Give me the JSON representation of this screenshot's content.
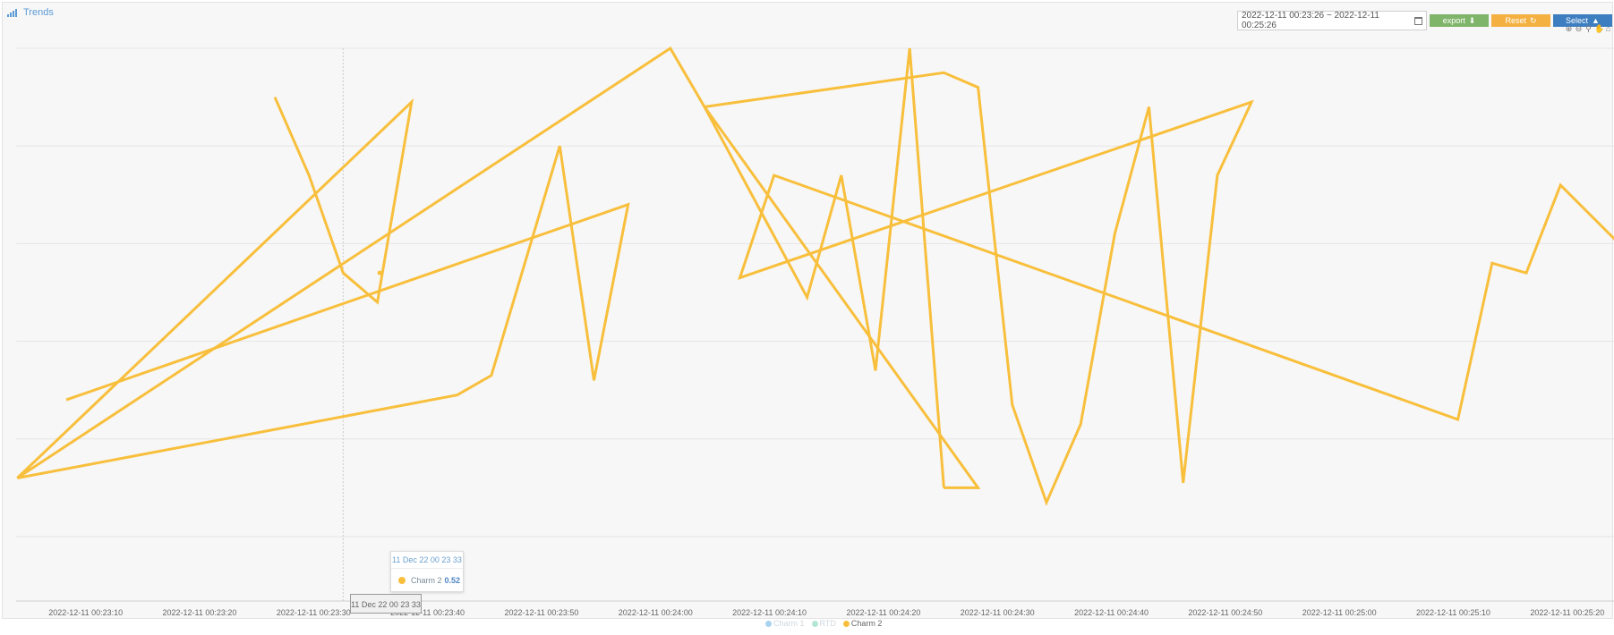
{
  "header": {
    "title": "Trends"
  },
  "toolbar": {
    "date_range": "2022-12-11 00:23:26 ~ 2022-12-11 00:25:26",
    "export_label": "export",
    "reset_label": "Reset",
    "select_label": "Select",
    "colors": {
      "export": "#7fb56a",
      "reset": "#f4b142",
      "select": "#3d7ec1"
    }
  },
  "tooltip": {
    "time": "11 Dec 22 00 23 33",
    "series": "Charm 2",
    "value": "0.52"
  },
  "crosshair_label": "11 Dec 22 00 23 33",
  "legend": [
    {
      "name": "Charm 1",
      "color": "#a8d3f0",
      "active": false
    },
    {
      "name": "RTD",
      "color": "#b3e6d5",
      "active": false
    },
    {
      "name": "Charm 2",
      "color": "#f8bf3c",
      "active": true
    }
  ],
  "chart_data": {
    "type": "line",
    "x_tick_labels": [
      "2022-12-11 00:23:10",
      "2022-12-11 00:23:20",
      "2022-12-11 00:23:30",
      "2022-12-11 00:23:40",
      "2022-12-11 00:23:50",
      "2022-12-11 00:24:00",
      "2022-12-11 00:24:10",
      "2022-12-11 00:24:20",
      "2022-12-11 00:24:30",
      "2022-12-11 00:24:40",
      "2022-12-11 00:24:50",
      "2022-12-11 00:25:00",
      "2022-12-11 00:25:10",
      "2022-12-11 00:25:20"
    ],
    "x_tick_seconds": [
      10,
      20,
      30,
      40,
      50,
      60,
      70,
      80,
      90,
      100,
      110,
      120,
      130,
      140
    ],
    "xlim": [
      3.9,
      144.1
    ],
    "ylim": [
      0,
      1
    ],
    "grid": true,
    "series": [
      {
        "name": "Charm 2",
        "color": "#f8bf3c",
        "points": [
          [
            26.6,
            0.9
          ],
          [
            29.6,
            0.74
          ],
          [
            32.6,
            0.54
          ],
          [
            35.6,
            0.48
          ],
          [
            38.6,
            0.89
          ],
          [
            4.0,
            0.12
          ],
          [
            61.3,
            1.0
          ],
          [
            64.3,
            0.88
          ],
          [
            85.3,
            0.95
          ],
          [
            88.3,
            0.92
          ],
          [
            91.3,
            0.27
          ],
          [
            94.3,
            0.07
          ],
          [
            97.3,
            0.23
          ],
          [
            100.3,
            0.62
          ],
          [
            103.3,
            0.88
          ],
          [
            106.3,
            0.11
          ],
          [
            109.3,
            0.74
          ],
          [
            112.3,
            0.89
          ],
          [
            67.4,
            0.53
          ],
          [
            70.4,
            0.74
          ],
          [
            130.4,
            0.24
          ],
          [
            133.4,
            0.56
          ],
          [
            136.4,
            0.54
          ],
          [
            139.4,
            0.72
          ],
          [
            142.4,
            0.65
          ],
          [
            145.4,
            0.58
          ]
        ]
      },
      {
        "name": "Charm 2 (segment 2)",
        "color": "#f8bf3c",
        "points": [
          [
            8.3,
            0.28
          ],
          [
            57.6,
            0.68
          ],
          [
            54.6,
            0.32
          ],
          [
            51.6,
            0.8
          ],
          [
            45.6,
            0.33
          ],
          [
            42.6,
            0.29
          ],
          [
            4.0,
            0.12
          ]
        ]
      },
      {
        "name": "Charm 2 (segment 3)",
        "color": "#f8bf3c",
        "points": [
          [
            64.3,
            0.88
          ],
          [
            88.3,
            0.1
          ],
          [
            85.3,
            0.1
          ]
        ]
      },
      {
        "name": "Charm 2 (segment 4)",
        "color": "#f8bf3c",
        "points": [
          [
            64.3,
            0.88
          ],
          [
            73.3,
            0.49
          ],
          [
            76.3,
            0.74
          ],
          [
            79.3,
            0.34
          ],
          [
            82.3,
            1.0
          ],
          [
            85.3,
            0.1
          ]
        ]
      }
    ],
    "hover_point": {
      "x": 35.8,
      "y": 0.54
    },
    "crosshair_x": 32.6
  }
}
